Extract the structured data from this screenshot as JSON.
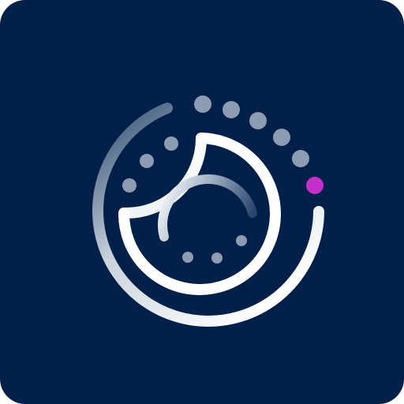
{
  "app_icon": {
    "icon_name": "circular-loader-logo-icon",
    "colors": {
      "background": "#012049",
      "arc_light": "#ffffff",
      "arc_fade": "#5a7796",
      "dot": "#8d9cb2",
      "accent_dot": "#c431c9"
    }
  }
}
